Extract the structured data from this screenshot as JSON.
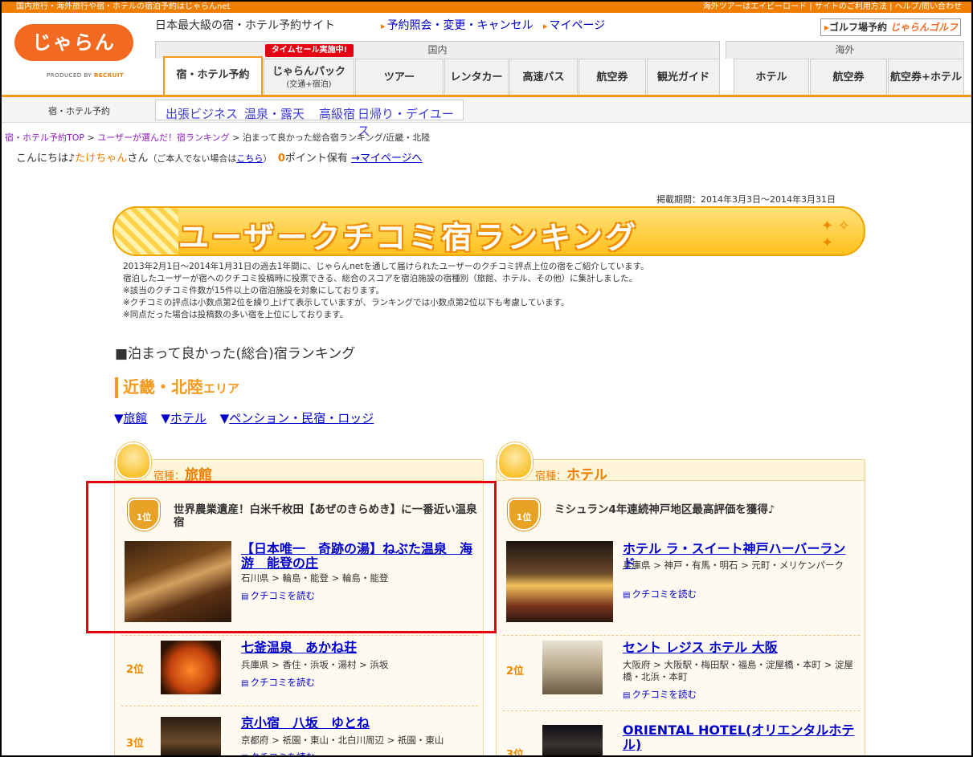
{
  "topbar": {
    "left": "国内旅行・海外旅行や宿・ホテルの宿泊予約はじゃらんnet",
    "right": "海外ツアーはエイビーロード | サイトのご利用方法 | ヘルプ/問い合わせ"
  },
  "header": {
    "logo": "じゃらん",
    "produced_prefix": "PRODUCED BY ",
    "produced_brand": "RECRUIT",
    "tagline": "日本最大級の宿・ホテル予約サイト",
    "links": [
      "予約照会・変更・キャンセル",
      "マイページ"
    ],
    "golf_label": "ゴルフ場予約",
    "golf_logo": "じゃらんゴルフ"
  },
  "nav": {
    "domestic": "国内",
    "overseas": "海外",
    "sale_badge": "タイムセール実施中!",
    "tabs": [
      {
        "label": "宿・ホテル予約"
      },
      {
        "label": "じゃらんパック",
        "sub": "(交通+宿泊)"
      },
      {
        "label": "ツアー"
      },
      {
        "label": "レンタカー"
      },
      {
        "label": "高速バス"
      },
      {
        "label": "航空券"
      },
      {
        "label": "観光ガイド"
      },
      {
        "label": "ホテル"
      },
      {
        "label": "航空券"
      },
      {
        "label": "航空券+ホテル"
      }
    ]
  },
  "subnav": {
    "label": "宿・ホテル予約",
    "links": [
      "出張ビジネス",
      "温泉・露天",
      "高級宿",
      "日帰り・デイユース"
    ]
  },
  "breadcrumb": {
    "items": [
      "宿・ホテル予約TOP",
      "ユーザーが選んだ！宿ランキング"
    ],
    "sep": " > ",
    "current": "泊まって良かった総合宿ランキング/近畿・北陸"
  },
  "greeting": {
    "prefix": "こんにちは♪",
    "name": "たけちゃん",
    "suffix": "さん",
    "note": "（ご本人でない場合は",
    "link": "こちら",
    "note_end": "）",
    "points": "0",
    "points_label": "ポイント保有",
    "mypage": "→マイページへ"
  },
  "period": "掲載期間：2014年3月3日～2014年3月31日",
  "banner": {
    "title": "ユーザークチコミ宿ランキング"
  },
  "notes": [
    "2013年2月1日～2014年1月31日の過去1年間に、じゃらんnetを通して届けられたユーザーのクチコミ評点上位の宿をご紹介しています。",
    "宿泊したユーザーが宿へのクチコミ投稿時に投票できる、総合のスコアを宿泊施設の宿種別（旅館、ホテル、その他）に集計しました。",
    "※該当のクチコミ件数が15件以上の宿泊施設を対象にしております。",
    "※クチコミの評点は小数点第2位を繰り上げて表示していますが、ランキングでは小数点第2位以下も考慮しています。",
    "※同点だった場合は投稿数の多い宿を上位にしております。"
  ],
  "section_title": "■泊まって良かった(総合)宿ランキング",
  "area": {
    "name": "近畿・北陸",
    "suffix": "エリア"
  },
  "anchors": [
    "旅館",
    "ホテル",
    "ペンション・民宿・ロッジ"
  ],
  "columns": [
    {
      "prefix": "宿種：",
      "kind": "旅館",
      "first": {
        "rank": "1",
        "rank_unit": "位",
        "catch": "世界農業遺産！白米千枚田【あぜのきらめき】に一番近い温泉宿",
        "name": "【日本唯一　奇跡の湯】ねぶた温泉　海游　能登の庄",
        "addr": "石川県 > 輪島・能登 > 輪島・能登",
        "review": "クチコミを読む"
      },
      "others": [
        {
          "rank": "2",
          "rank_unit": "位",
          "name": "七釜温泉　あかね荘",
          "addr": "兵庫県 > 香住・浜坂・湯村 > 浜坂",
          "review": "クチコミを読む"
        },
        {
          "rank": "3",
          "rank_unit": "位",
          "name": "京小宿　八坂　ゆとね",
          "addr": "京都府 > 祇園・東山・北白川周辺 > 祇園・東山",
          "review": "クチコミを読む"
        }
      ]
    },
    {
      "prefix": "宿種：",
      "kind": "ホテル",
      "first": {
        "rank": "1",
        "rank_unit": "位",
        "catch": "ミシュラン4年連続神戸地区最高評価を獲得♪",
        "name": "ホテル ラ・スイート神戸ハーバーランド",
        "addr": "兵庫県 > 神戸・有馬・明石 > 元町・メリケンパーク",
        "review": "クチコミを読む"
      },
      "others": [
        {
          "rank": "2",
          "rank_unit": "位",
          "name": "セント レジス ホテル 大阪",
          "addr": "大阪府 > 大阪駅・梅田駅・福島・淀屋橋・本町 > 淀屋橋・北浜・本町",
          "review": "クチコミを読む"
        },
        {
          "rank": "3",
          "rank_unit": "位",
          "name": "ORIENTAL HOTEL(オリエンタルホテル)",
          "addr": "",
          "review": ""
        }
      ]
    }
  ],
  "colors": {
    "accent": "#ef7d00",
    "link": "#0000cc",
    "highlight": "#e60012"
  }
}
